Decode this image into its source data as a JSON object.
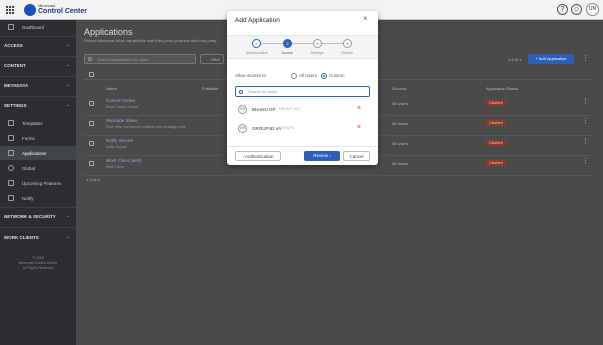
{
  "topbar": {
    "brand_small": "Mimecast",
    "brand": "Control Center",
    "help_icon": "?",
    "user_icon": "☺",
    "avatar": "UN",
    "avatar_chevron": "⌄"
  },
  "sidebar": {
    "dashboard": "Dashboard",
    "sections": [
      "ACCESS",
      "CONTENT",
      "METADATA",
      "SETTINGS",
      "NETWORK & SECURITY",
      "WORK CLIENTS"
    ],
    "settings_items": [
      "Templates",
      "Forms",
      "Applications",
      "Global",
      "Upcoming Features",
      "Notify"
    ],
    "footer": [
      "© 2025",
      "Mimecast Control Center",
      "All Rights Reserved"
    ],
    "chevron": "⌄"
  },
  "page": {
    "title": "Applications",
    "subtitle": "Extend Mimecast Work capabilities with third party products and third party",
    "search_placeholder": "Search applications by name",
    "filter_label": "Filter",
    "count_label": "1-4 of 4",
    "add_button": "+ Add Application",
    "columns": [
      "Name",
      "Publisher",
      "Security",
      "Application Status"
    ],
    "rows": [
      {
        "name": "Control Center",
        "desc": "Email Control Center",
        "security": "All Users",
        "status": "Disabled"
      },
      {
        "name": "Message Share",
        "desc": "Post, view, and secure mailings with message tools",
        "security": "All Users",
        "status": "Disabled"
      },
      {
        "name": "Notify Secure",
        "desc": "Notify Secure",
        "security": "All Users",
        "status": "Disabled"
      },
      {
        "name": "Work Client (web)",
        "desc": "Work Client",
        "security": "All Users",
        "status": "Disabled"
      }
    ],
    "footer_count": "1-4 of 4",
    "kebab": "⋮"
  },
  "modal": {
    "title": "Add Application",
    "close": "×",
    "steps": [
      {
        "num": "✓",
        "label": "Authentication"
      },
      {
        "num": "2",
        "label": "Access"
      },
      {
        "num": "3",
        "label": "Settings"
      },
      {
        "num": "4",
        "label": "Review"
      }
    ],
    "allow_access_label": "Allow access to",
    "radio_all": "All Users",
    "radio_custom": "Custom",
    "search_placeholder": "Search for users",
    "groups": [
      {
        "icon": "GR",
        "name": "BHANU GP",
        "sub": "GROUP LIST"
      },
      {
        "icon": "GR",
        "name": "GROUP4D.VA",
        "sub": "GROUPS"
      }
    ],
    "remove": "×",
    "back_button": "‹  Authentication",
    "review_button": "Review  ›",
    "cancel_button": "Cancel"
  },
  "colors": {
    "accent": "#2d5fb8",
    "sidebar": "#2b2d31",
    "danger": "#d33333"
  }
}
